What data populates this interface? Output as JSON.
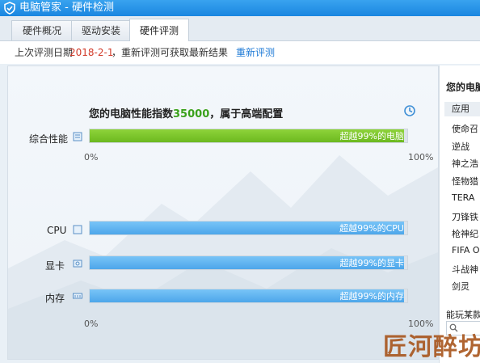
{
  "window": {
    "title": "电脑管家 - 硬件检测"
  },
  "tabs": [
    {
      "label": "硬件概况"
    },
    {
      "label": "驱动安装"
    },
    {
      "label": "硬件评测"
    }
  ],
  "info": {
    "label": "上次评测日期",
    "date": "2018-2-1",
    "message": "，重新评测可获取最新结果",
    "link": "重新评测"
  },
  "score": {
    "prefix": "您的电脑性能指数",
    "value": "35000",
    "suffix": "，属于高端配置"
  },
  "overall": {
    "label": "综合性能",
    "bar_text": "超越99%的电脑",
    "fraction": 0.99,
    "axis_min": "0%",
    "axis_max": "100%"
  },
  "components": [
    {
      "label": "CPU",
      "bar_text": "超越99%的CPU",
      "fraction": 0.99
    },
    {
      "label": "显卡",
      "bar_text": "超越99%的显卡",
      "fraction": 0.99
    },
    {
      "label": "内存",
      "bar_text": "超越99%的内存",
      "fraction": 0.99
    }
  ],
  "component_axis": {
    "min": "0%",
    "max": "100%"
  },
  "sidebar": {
    "title": "您的电脑",
    "items": [
      "应用",
      "使命召",
      "逆战",
      "神之浩",
      "怪物猎",
      "TERA",
      "刀锋铁",
      "枪神纪",
      "FIFA On",
      "斗战神",
      "剑灵"
    ],
    "footer": "能玩某款"
  },
  "watermark": "匠河醉坊",
  "colors": {
    "accent": "#1a86e0",
    "date": "#d23b2a",
    "score": "#3aa11b",
    "green_bar": "#7bc62a",
    "blue_bar": "#5db2ef"
  }
}
